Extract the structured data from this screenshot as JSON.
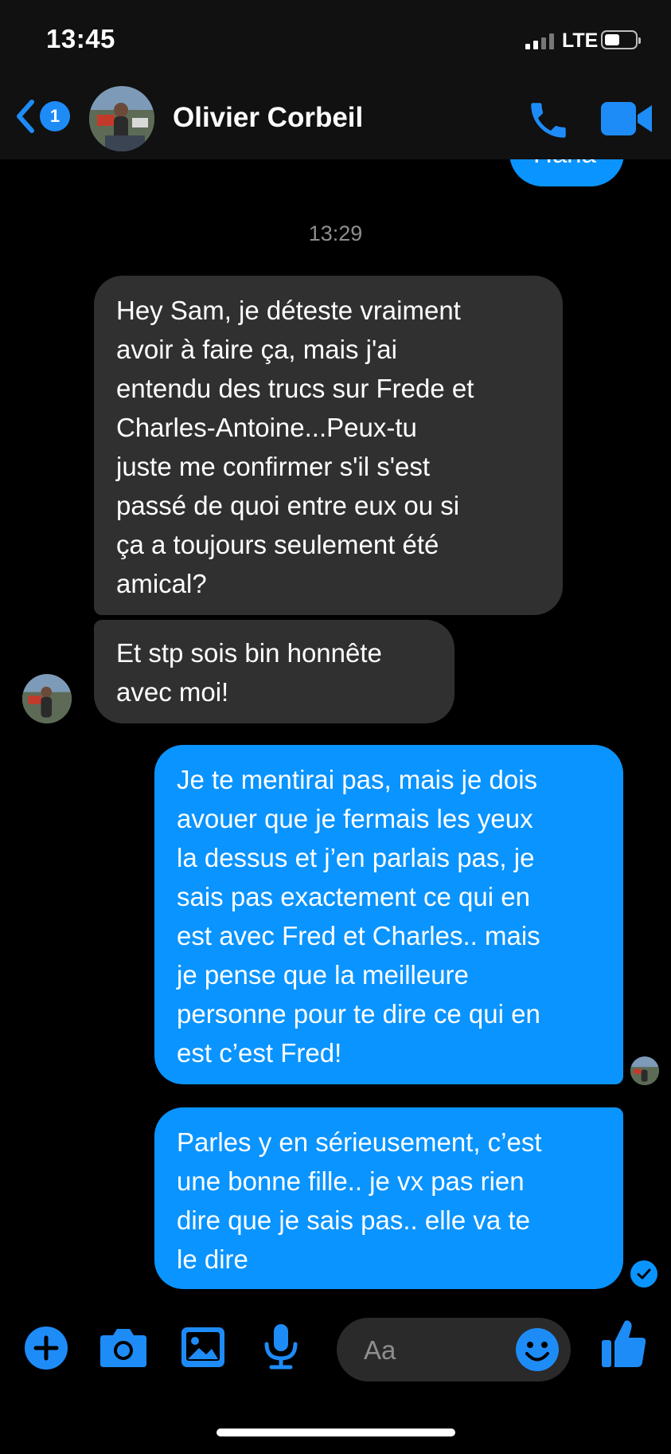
{
  "status_bar": {
    "time": "13:45",
    "network": "LTE"
  },
  "header": {
    "back_badge": "1",
    "contact_name": "Olivier Corbeil"
  },
  "conversation": {
    "cut_off_message": "Haha",
    "timestamp": "13:29",
    "incoming": [
      {
        "lines": [
          "Hey Sam, je déteste vraiment",
          "avoir à faire ça, mais j'ai",
          "entendu des trucs sur Frede et",
          "Charles-Antoine...Peux-tu",
          "juste me confirmer s'il s'est",
          "passé de quoi entre eux ou si",
          "ça a toujours seulement été",
          "amical?"
        ]
      },
      {
        "lines": [
          "Et stp sois bin honnête",
          "avec moi!"
        ]
      }
    ],
    "outgoing": [
      {
        "lines": [
          "Je te mentirai pas, mais je dois",
          "avouer que je fermais les yeux",
          "la dessus et j’en parlais pas, je",
          "sais pas exactement ce qui en",
          "est avec Fred et Charles.. mais",
          "je pense que la meilleure",
          "personne pour te dire ce qui en",
          "est c’est Fred!"
        ]
      },
      {
        "lines": [
          "Parles y en sérieusement, c’est",
          "une bonne fille.. je vx pas rien",
          "dire que je sais pas.. elle va te",
          "le dire"
        ]
      }
    ]
  },
  "composer": {
    "placeholder": "Aa"
  },
  "colors": {
    "accent": "#0a94ff",
    "incoming_bubble": "#303030",
    "background": "#000000"
  }
}
